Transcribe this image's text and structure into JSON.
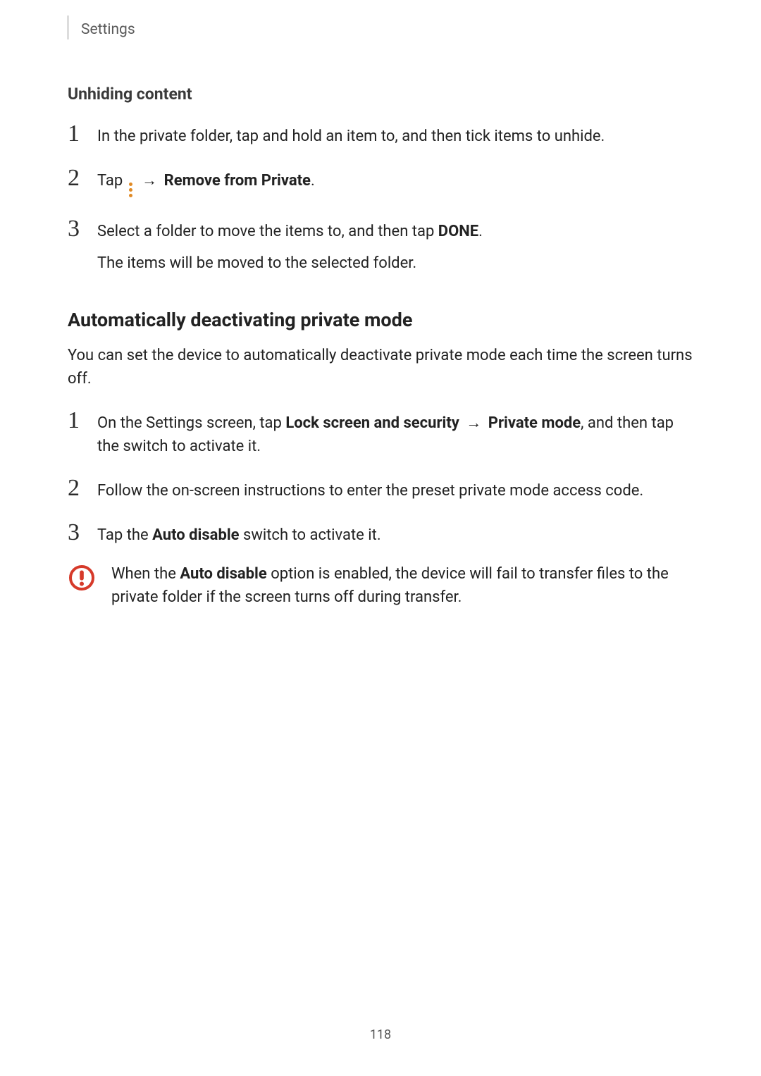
{
  "header": {
    "title": "Settings"
  },
  "section1": {
    "title": "Unhiding content",
    "steps": [
      {
        "num": "1",
        "text": "In the private folder, tap and hold an item to, and then tick items to unhide."
      },
      {
        "num": "2",
        "prefix": "Tap ",
        "after_icon": " → ",
        "bold": "Remove from Private",
        "suffix": "."
      },
      {
        "num": "3",
        "line1_prefix": "Select a folder to move the items to, and then tap ",
        "line1_bold": "DONE",
        "line1_suffix": ".",
        "line2": "The items will be moved to the selected folder."
      }
    ]
  },
  "section2": {
    "title": "Automatically deactivating private mode",
    "intro": "You can set the device to automatically deactivate private mode each time the screen turns off.",
    "steps": [
      {
        "num": "1",
        "p1": "On the Settings screen, tap ",
        "b1": "Lock screen and security",
        "arrow": " → ",
        "b2": "Private mode",
        "p2": ", and then tap the switch to activate it."
      },
      {
        "num": "2",
        "text": "Follow the on-screen instructions to enter the preset private mode access code."
      },
      {
        "num": "3",
        "p1": "Tap the ",
        "b1": "Auto disable",
        "p2": " switch to activate it."
      }
    ],
    "caution": {
      "p1": "When the ",
      "b1": "Auto disable",
      "p2": " option is enabled, the device will fail to transfer files to the private folder if the screen turns off during transfer."
    }
  },
  "page_number": "118"
}
